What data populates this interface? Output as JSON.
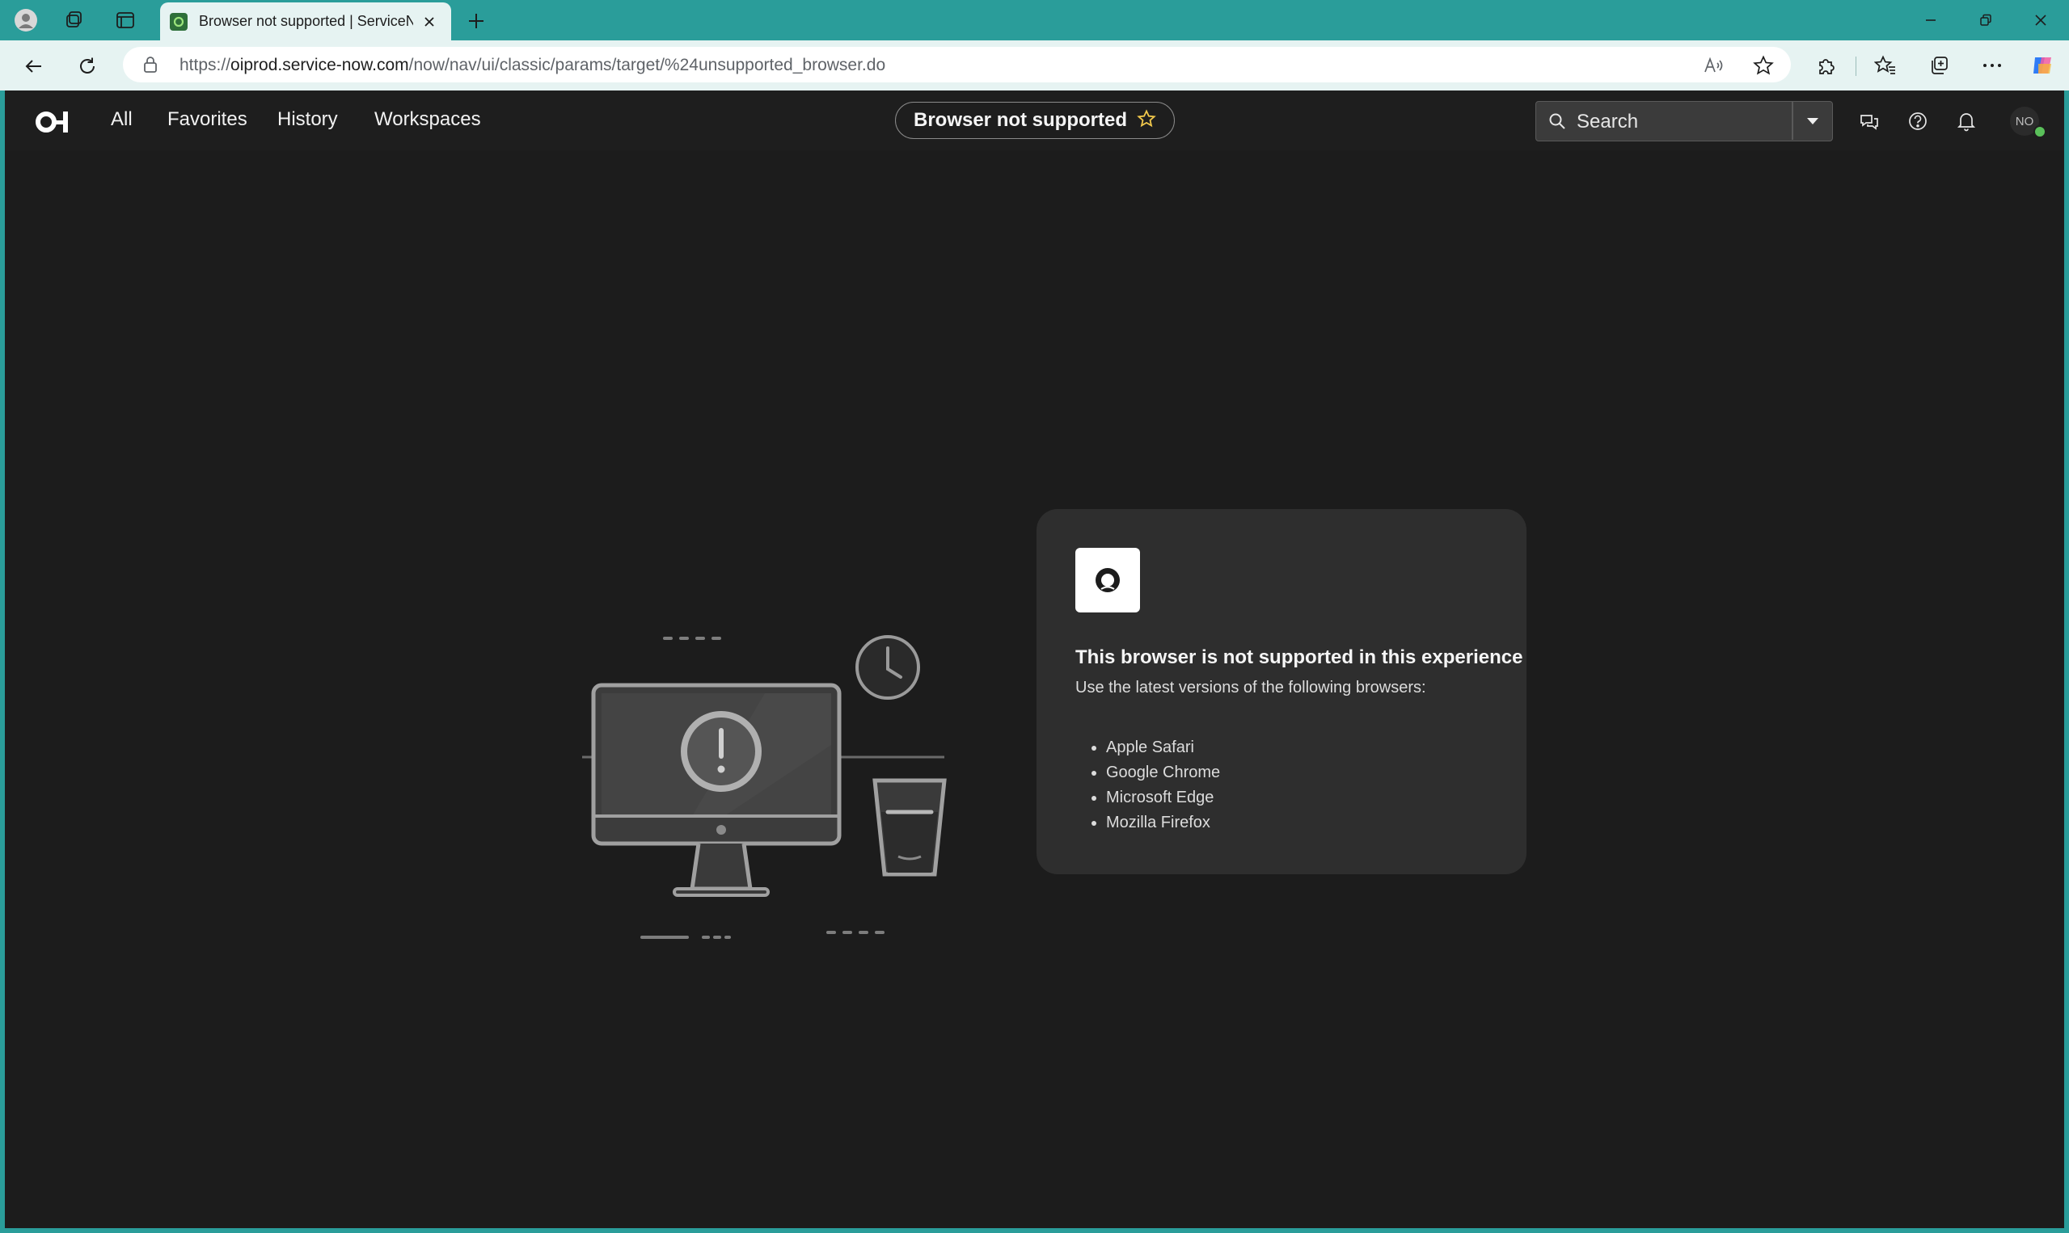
{
  "browser": {
    "tab": {
      "title": "Browser not supported | ServiceNow"
    },
    "address_bar": {
      "url_prefix": "https://",
      "url_host": "oiprod.service-now.com",
      "url_path": "/now/nav/ui/classic/params/target/%24unsupported_browser.do"
    }
  },
  "app_nav": {
    "links": [
      {
        "label": "All"
      },
      {
        "label": "Favorites"
      },
      {
        "label": "History"
      },
      {
        "label": "Workspaces"
      }
    ],
    "context_title": "Browser not supported",
    "search": {
      "placeholder": "Search"
    },
    "avatar_initials": "NO"
  },
  "message": {
    "title": "This browser is not supported in this experience",
    "subtitle": "Use the latest versions of the following browsers:",
    "browsers": [
      "Apple Safari",
      "Google Chrome",
      "Microsoft Edge",
      "Mozilla Firefox"
    ]
  },
  "colors": {
    "chrome_accent": "#2a9d9a",
    "chrome_light": "#e6f3f2",
    "app_background": "#1c1c1c",
    "card_background": "#2e2e2e",
    "favorite_star": "#f2c94c",
    "presence_online": "#5ac05a"
  },
  "icons": {
    "profile": "profile-icon",
    "workspaces": "workspaces-icon",
    "tab_actions": "tab-actions-icon",
    "back": "back-arrow-icon",
    "refresh": "refresh-icon",
    "lock": "lock-icon",
    "read_aloud": "read-aloud-icon",
    "favorite": "star-icon",
    "extensions": "extensions-icon",
    "favorites_bar": "favorites-icon",
    "collections": "collections-icon",
    "more": "more-icon",
    "copilot": "copilot-icon",
    "chat": "chat-icon",
    "help": "help-icon",
    "notifications": "bell-icon"
  }
}
